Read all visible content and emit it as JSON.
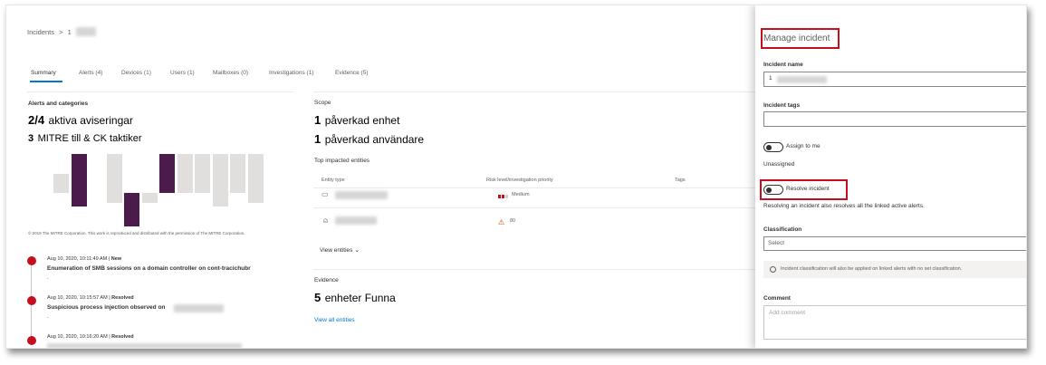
{
  "breadcrumb": {
    "root": "Incidents",
    "separator": ">",
    "current": "1"
  },
  "tabs": [
    {
      "label": "Summary",
      "active": true
    },
    {
      "label": "Alerts (4)"
    },
    {
      "label": "Devices (1)"
    },
    {
      "label": "Users (1)"
    },
    {
      "label": "Mailboxes (0)"
    },
    {
      "label": "Investigations (1)"
    },
    {
      "label": "Evidence (5)"
    }
  ],
  "alerts": {
    "section_title": "Alerts and categories",
    "active_count": "2/4",
    "active_label": "aktiva aviseringar",
    "mitre_count": "3",
    "mitre_label": "MITRE till & CK taktiker",
    "copyright": "© 2019 The MITRE Corporation. This work is reproduced and distributed with the permission of The MITRE Corporation.",
    "bar_chart": {
      "up": [
        0.5,
        1,
        0,
        1,
        0,
        0,
        1,
        1,
        1,
        1,
        1,
        1
      ],
      "down": [
        0,
        0.4,
        0,
        0.3,
        1,
        0.3,
        0,
        0,
        0,
        0.4,
        0,
        0.3
      ],
      "highlight": [
        false,
        true,
        false,
        false,
        true,
        false,
        true,
        false,
        false,
        false,
        false,
        false
      ]
    }
  },
  "timeline": [
    {
      "time": "Aug 10, 2020, 10:11:49 AM",
      "status": "New",
      "title": "Enumeration of SMB sessions on a domain controller on cont-tracichubr",
      "sub": "."
    },
    {
      "time": "Aug 10, 2020, 10:15:57 AM",
      "status": "Resolved",
      "title": "Suspicious process injection observed on",
      "sub": "."
    },
    {
      "time": "Aug 10, 2020, 10:16:20 AM",
      "status": "Resolved",
      "title": "",
      "sub": ""
    }
  ],
  "scope": {
    "section_title": "Scope",
    "devices_count": "1",
    "devices_label": "påverkad enhet",
    "users_count": "1",
    "users_label": "påverkad användare",
    "top_entities_title": "Top impacted entities",
    "columns": [
      "Entity type",
      "Risk level/investigation priority",
      "Tags"
    ],
    "rows": [
      {
        "entity_icon": "computer-icon",
        "risk_text": "Medium",
        "risk_color": "#c50f1f"
      },
      {
        "entity_icon": "user-icon",
        "risk_text": "80",
        "risk_color": "#d83b01"
      }
    ],
    "view_entities": "View entities"
  },
  "evidence": {
    "section_title": "Evidence",
    "count": "5",
    "label": "enheter Funna",
    "view_all": "View all entities"
  },
  "manage": {
    "title": "Manage incident",
    "name_label": "Incident name",
    "name_value": "1",
    "tags_label": "Incident tags",
    "tags_value": "",
    "assign_label": "Assign to me",
    "assignee": "Unassigned",
    "resolve_label": "Resolve incident",
    "resolve_note": "Resolving an incident also resolves all the linked active alerts.",
    "classification_label": "Classification",
    "classification_placeholder": "Select",
    "classification_info": "Incident classification will also be applied on linked alerts with no set classification.",
    "comment_label": "Comment",
    "comment_placeholder": "Add comment"
  },
  "colors": {
    "accent": "#0078d4",
    "highlight_box": "#c50f1f",
    "bar_dark": "#4b1b4c",
    "bar_light": "#e1dfdd",
    "timeline_dot": "#c50f1f"
  }
}
